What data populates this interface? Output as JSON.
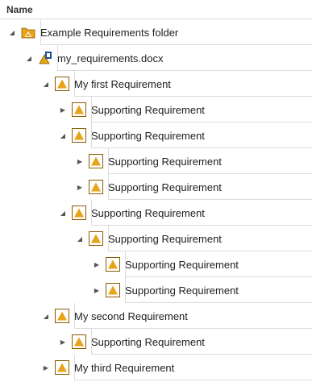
{
  "header": {
    "name_col": "Name"
  },
  "tree": [
    {
      "label": "Example Requirements folder",
      "icon": "folder-requirement-icon",
      "depth": 0,
      "expanded": true
    },
    {
      "label": "my_requirements.docx",
      "icon": "document-requirement-icon",
      "depth": 1,
      "expanded": true
    },
    {
      "label": "My first Requirement",
      "icon": "requirement-icon",
      "depth": 2,
      "expanded": true
    },
    {
      "label": "Supporting Requirement",
      "icon": "requirement-icon",
      "depth": 3,
      "expanded": false
    },
    {
      "label": "Supporting Requirement",
      "icon": "requirement-icon",
      "depth": 3,
      "expanded": true
    },
    {
      "label": "Supporting Requirement",
      "icon": "requirement-icon",
      "depth": 4,
      "expanded": false
    },
    {
      "label": "Supporting Requirement",
      "icon": "requirement-icon",
      "depth": 4,
      "expanded": false
    },
    {
      "label": "Supporting Requirement",
      "icon": "requirement-icon",
      "depth": 3,
      "expanded": true
    },
    {
      "label": "Supporting Requirement",
      "icon": "requirement-icon",
      "depth": 4,
      "expanded": true
    },
    {
      "label": "Supporting Requirement",
      "icon": "requirement-icon",
      "depth": 5,
      "expanded": false
    },
    {
      "label": "Supporting Requirement",
      "icon": "requirement-icon",
      "depth": 5,
      "expanded": false
    },
    {
      "label": "My second Requirement",
      "icon": "requirement-icon",
      "depth": 2,
      "expanded": true
    },
    {
      "label": "Supporting Requirement",
      "icon": "requirement-icon",
      "depth": 3,
      "expanded": false
    },
    {
      "label": "My third Requirement",
      "icon": "requirement-icon",
      "depth": 2,
      "expanded": false
    }
  ],
  "colors": {
    "accent": "#e8a317",
    "accent_dark": "#8a5a00",
    "doc_blue": "#1f4e9a"
  }
}
